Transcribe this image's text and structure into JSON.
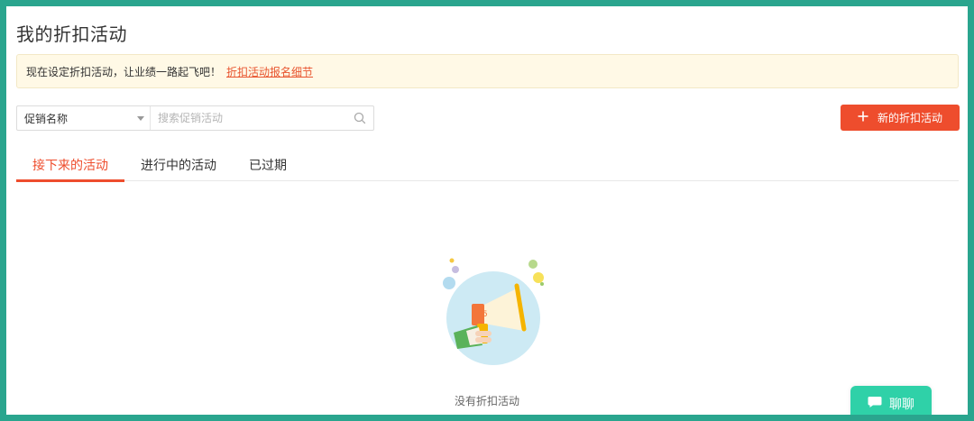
{
  "page": {
    "title": "我的折扣活动"
  },
  "notice": {
    "text": "现在设定折扣活动，让业绩一路起飞吧！",
    "link": "折扣活动报名细节"
  },
  "filter": {
    "select_value": "促销名称",
    "search_placeholder": "搜索促销活动"
  },
  "actions": {
    "add_label": "新的折扣活动"
  },
  "tabs": [
    {
      "label": "接下来的活动",
      "active": true
    },
    {
      "label": "进行中的活动",
      "active": false
    },
    {
      "label": "已过期",
      "active": false
    }
  ],
  "empty": {
    "text": "没有折扣活动"
  },
  "chat": {
    "label": "聊聊"
  },
  "colors": {
    "accent": "#ee4d2d",
    "notice_bg": "#fff9e6",
    "chat": "#2fd1a8",
    "frame": "#2aa58e"
  }
}
